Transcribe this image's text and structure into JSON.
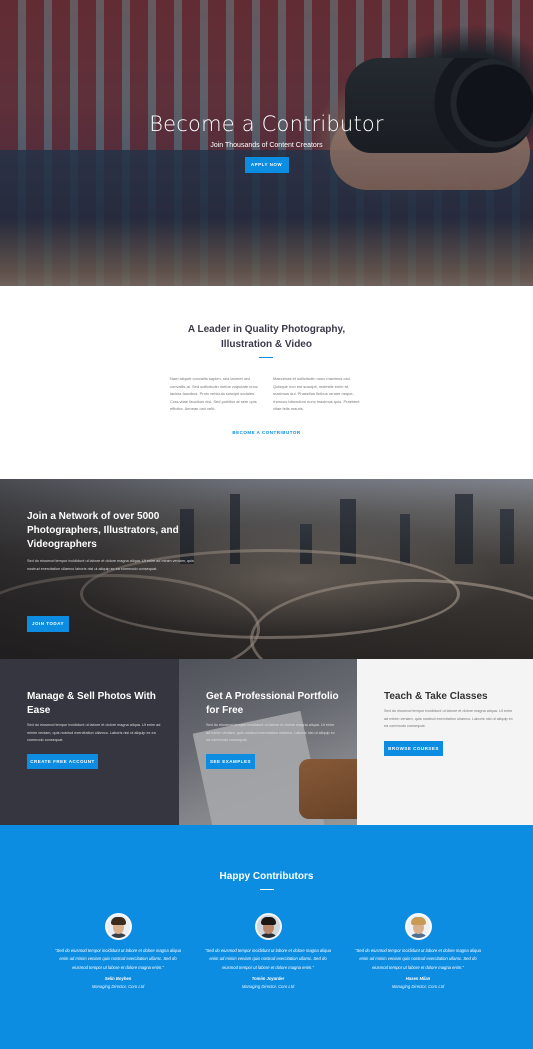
{
  "hero": {
    "title": "Become a Contributor",
    "subtitle": "Join Thousands of Content Creators",
    "button": "APPLY NOW"
  },
  "leader": {
    "title_line1": "A Leader in Quality Photography,",
    "title_line2": "Illustration & Video",
    "col1": "Nam aliquet convallis sapien, sed laoreet orci convallis at. Sed sollicitudin metus vulputate nunc lacinia faucibus. Proin vehicula suscipit sodales. Cras vitae faucibus nisl. Sed porttitor at sem quis efficitur. Aenean orci velit.",
    "col2": "Maecenas et sollicitudin nunc maximus orci. Quisque non est suscipit, molestie enim at, maximus dui. Phasellus finibus ornare neque, rhoncus bibendum nunc maximus quis. Praesent vitae felis mauris.",
    "link": "BECOME A CONTRIBUTOR"
  },
  "network": {
    "title": "Join a Network of over 5000 Photographers, Illustrators, and Videographers",
    "text": "Sed do eiusmod tempor incididunt ut labore et dolore magna aliqua. Ut enim ad minim veniam, quis nostrud exercitation ullamco laboris nisi ut aliquip ex ea commodo consequat.",
    "button": "JOIN TODAY"
  },
  "features": [
    {
      "title": "Manage & Sell Photos With Ease",
      "text": "Sed do eiusmod tempor incididunt ut labore et dolore magna aliqua. Ut enim ad minim veniam, quis nostrud exercitation ullamco. Laboris nisi ut aliquip ex ea commodo consequat.",
      "button": "CREATE FREE ACCOUNT"
    },
    {
      "title": "Get A Professional Portfolio for Free",
      "text": "Sed do eiusmod tempor incididunt ut labore et dolore magna aliqua. Ut enim ad minim veniam, quis nostrud exercitation ullamco. Laboris nisi ut aliquip ex ea commodo consequat.",
      "button": "SEE EXAMPLES"
    },
    {
      "title": "Teach & Take Classes",
      "text": "Sed do eiusmod tempor incididunt ut labore et dolore magna aliqua. Ut enim ad minim veniam, quis nostrud exercitation ullamco. Laboris nisi ut aliquip ex ea commodo consequat.",
      "button": "BROWSE COURSES"
    }
  ],
  "testimonials": {
    "title": "Happy Contributors",
    "items": [
      {
        "quote": "\"Sed do eiusmod tempor incididunt ut labore et dolore magna aliqua enim ad minim veniam quis nostrud exercitation ullamc. Sed do eiusmod tempor ut labore et dolore magna enim.\"",
        "name": "Selin Boyhen",
        "role": "Managing Director, Coro Ltd"
      },
      {
        "quote": "\"Sed do eiusmod tempor incididunt ut labore et dolore magna aliqua enim ad minim veniam quis nostrud exercitation ullamc. Sed do eiusmod tempor ut labore et dolore magna enim.\"",
        "name": "Tomim Joyarder",
        "role": "Managing Director, Coro Ltd"
      },
      {
        "quote": "\"Sed do eiusmod tempor incididunt ut labore et dolore magna aliqua enim ad minim veniam quis nostrud exercitation ullamc. Sed do eiusmod tempor ut labore et dolore magna enim.\"",
        "name": "Hasen Milan",
        "role": "Managing Director, Coro Ltd"
      }
    ]
  },
  "colors": {
    "accent": "#0c8de2",
    "dark_panel": "#35363f",
    "light_panel": "#f4f4f4"
  }
}
